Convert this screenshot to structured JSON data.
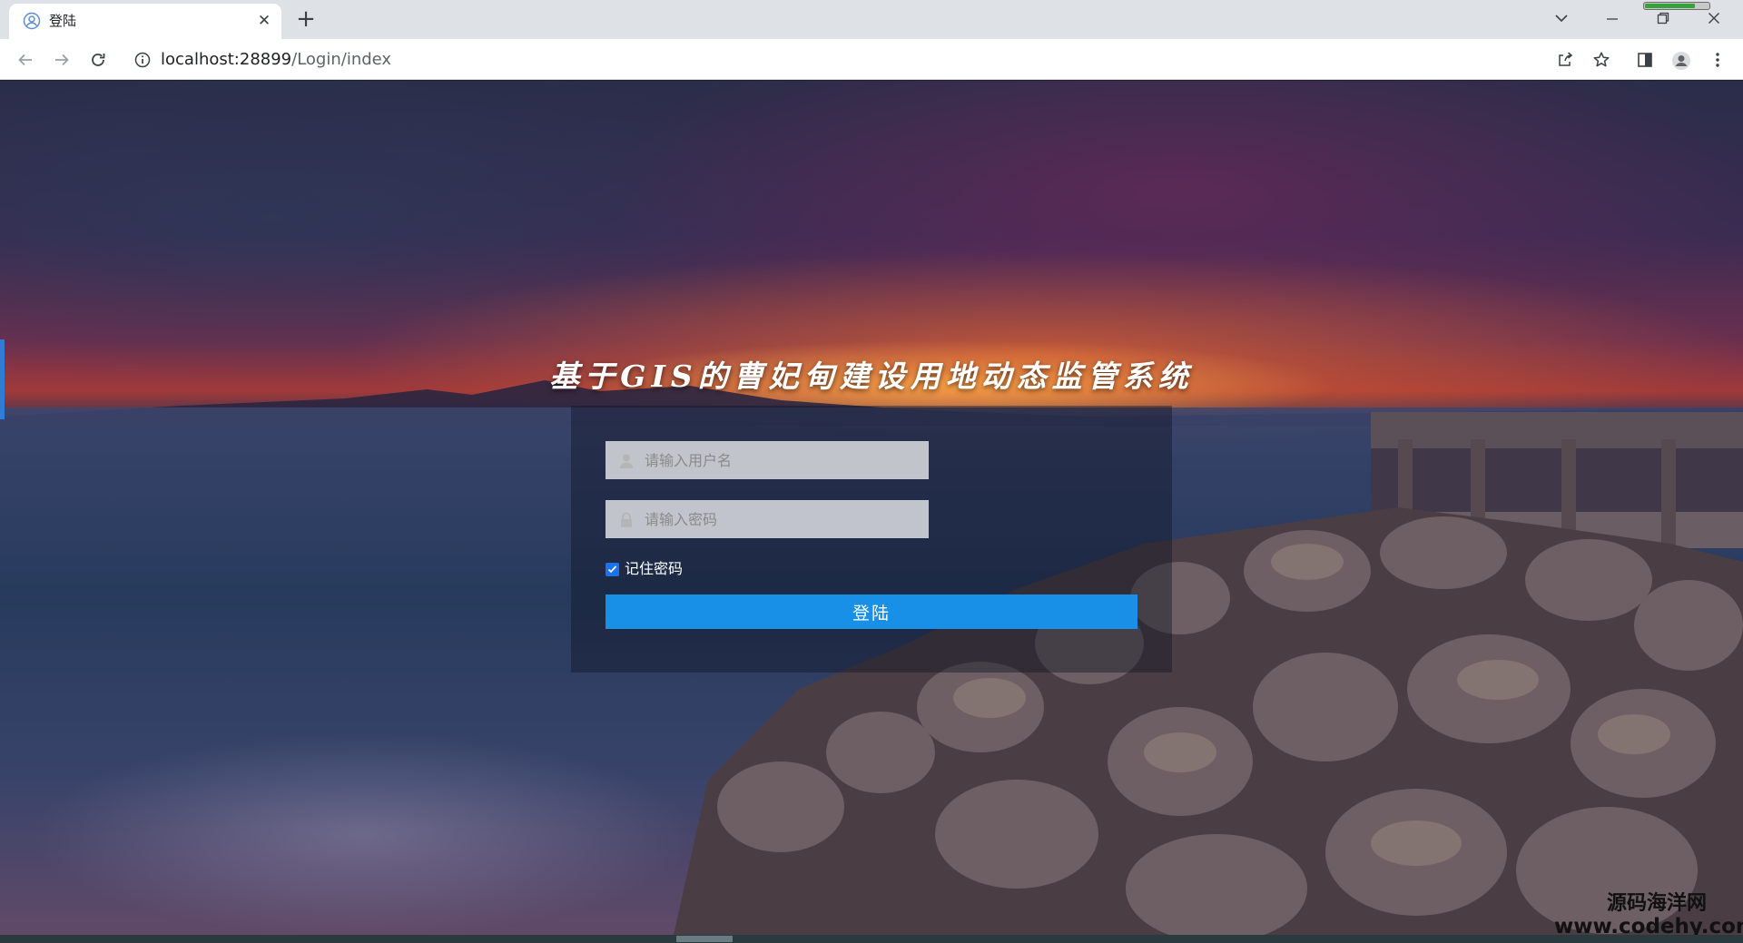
{
  "browser": {
    "tab": {
      "title": "登陆",
      "close_glyph": "✕"
    },
    "new_tab_glyph": "+",
    "address": {
      "host": "localhost:28899",
      "path": "/Login/index"
    },
    "battery_level": 0.78
  },
  "login": {
    "title": "基于GIS的曹妃甸建设用地动态监管系统",
    "username_placeholder": "请输入用户名",
    "password_placeholder": "请输入密码",
    "remember_label": "记住密码",
    "remember_checked": true,
    "submit_label": "登陆"
  },
  "watermark": {
    "line1": "源码海洋网",
    "line2": "www.codehy.com"
  },
  "colors": {
    "accent": "#1890e8",
    "checkbox": "#1a73e8",
    "left_accent": "#2f7bd6"
  }
}
